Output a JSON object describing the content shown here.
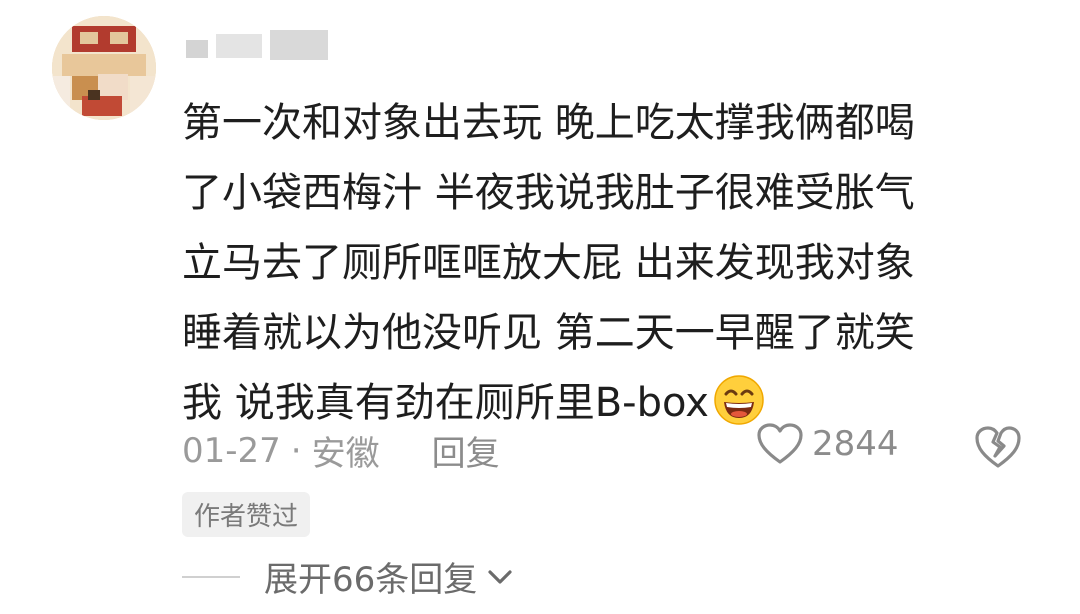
{
  "comment": {
    "lines": [
      "第一次和对象出去玩 晚上吃太撑我俩都喝",
      "了小袋西梅汁 半夜我说我肚子很难受胀气",
      "立马去了厕所哐哐放大屁 出来发现我对象",
      "睡着就以为他没听见 第二天一早醒了就笑",
      "我 说我真有劲在厕所里B-box"
    ],
    "emoji": "grinning-face-emoji"
  },
  "meta": {
    "date": "01-27",
    "separator": "·",
    "location": "安徽",
    "reply_label": "回复"
  },
  "actions": {
    "like_count": "2844",
    "like_icon": "heart-outline-icon",
    "dislike_icon": "broken-heart-icon"
  },
  "badge": {
    "author_liked": "作者赞过"
  },
  "expand": {
    "label": "展开66条回复",
    "icon": "chevron-down-icon"
  },
  "colors": {
    "text": "#1e1e1e",
    "muted": "#9a9a9a",
    "badge_bg": "#f0f0f0"
  }
}
